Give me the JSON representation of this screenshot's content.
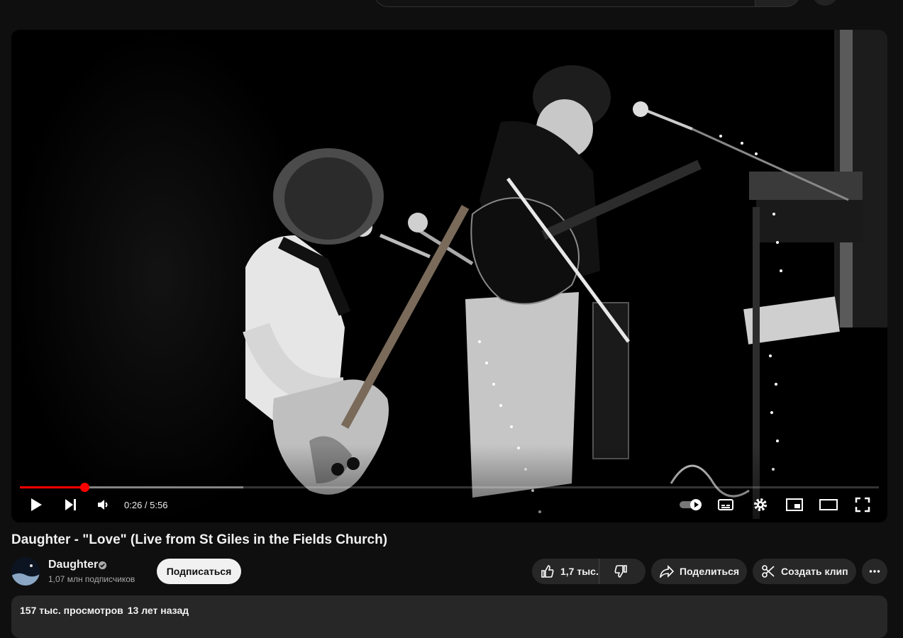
{
  "player": {
    "current_time": "0:26",
    "duration": "5:56",
    "progress_played": 0.075,
    "progress_buffered": 0.26,
    "accent_color": "#ff0000"
  },
  "video": {
    "title": "Daughter - \"Love\" (Live from St Giles in the Fields Church)"
  },
  "channel": {
    "name": "Daughter",
    "subscribers": "1,07 млн подписчиков",
    "subscribe_label": "Подписаться"
  },
  "actions": {
    "likes": "1,7 тыс.",
    "share_label": "Поделиться",
    "clip_label": "Создать клип"
  },
  "description": {
    "views": "157 тыс. просмотров",
    "age": "13 лет назад"
  },
  "icons": [
    "play-icon",
    "next-icon",
    "volume-icon",
    "autoplay-toggle-icon",
    "subtitles-icon",
    "settings-icon",
    "miniplayer-icon",
    "theater-icon",
    "fullscreen-icon",
    "verified-icon",
    "like-icon",
    "dislike-icon",
    "share-icon",
    "scissors-icon",
    "more-icon"
  ]
}
